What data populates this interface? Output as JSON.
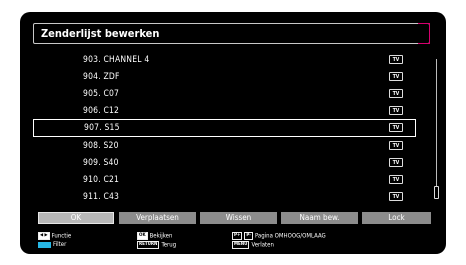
{
  "header": {
    "title": "Zenderlijst bewerken"
  },
  "channels": [
    {
      "label": "903. CHANNEL 4",
      "badge": "TV"
    },
    {
      "label": "904. ZDF",
      "badge": "TV"
    },
    {
      "label": "905. C07",
      "badge": "TV"
    },
    {
      "label": "906. C12",
      "badge": "TV"
    },
    {
      "label": "907. S15",
      "badge": "TV"
    },
    {
      "label": "908. S20",
      "badge": "TV"
    },
    {
      "label": "909. S40",
      "badge": "TV"
    },
    {
      "label": "910. C21",
      "badge": "TV"
    },
    {
      "label": "911. C43",
      "badge": "TV"
    }
  ],
  "buttons": {
    "ok": "OK",
    "move": "Verplaatsen",
    "delete": "Wissen",
    "rename": "Naam bew.",
    "lock": "Lock"
  },
  "hints": {
    "function": "Functie",
    "filter": "Filter",
    "ok_key": "OK",
    "view": "Bekijken",
    "return_key": "RETURN",
    "back": "Terug",
    "page_keys_1": "P+",
    "page_keys_2": "P-",
    "page": "Pagina OMHOOG/OMLAAG",
    "menu_key": "MENU",
    "exit": "Verlaten"
  },
  "colors": {
    "accent": "#d6006e",
    "filter_key": "#27b8e6",
    "button": "#8c8c8c"
  },
  "selected_index": 4
}
